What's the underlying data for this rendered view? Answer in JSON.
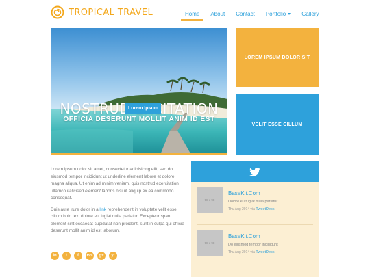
{
  "header": {
    "brand": "TROPICAL TRAVEL",
    "nav": [
      {
        "label": "Home",
        "active": true
      },
      {
        "label": "About"
      },
      {
        "label": "Contact"
      },
      {
        "label": "Portfolio",
        "dropdown": true
      },
      {
        "label": "Gallery"
      }
    ]
  },
  "hero": {
    "title": "NOSTRUD EXCITATION",
    "subtitle": "OFFICIA DESERUNT MOLLIT ANIM ID EST",
    "button": "Lorem Ipsum"
  },
  "boxes": [
    {
      "label": "LOREM IPSUM DOLOR SIT",
      "color": "#f3b23e"
    },
    {
      "label": "VELIT ESSE CILLUM",
      "color": "#2ea1db"
    }
  ],
  "content": {
    "p1_a": "Lorem ipsum dolor sit amet, consectetur adipisicing elit, sed do eiusmod tempor incididunt ut ",
    "p1_link": "underline element",
    "p1_b": " labore et dolore magna aliqua. Ut enim ad minim veniam, quis nostrud exercitation ullamco ",
    "p1_em": "italicised element",
    "p1_c": " laboris nisi ut aliquip ex ea commodo consequat.",
    "p2_a": "Duis aute irure dolor in a ",
    "p2_link": "link",
    "p2_b": " reprehenderit in voluptate velit esse cillum bold text dolore eu fugiat nulla pariatur. Excepteur span element sint occaecat cupidatat non proident, sunt in culpa qui officia deserunt mollit anim id est laborum."
  },
  "social": [
    "in",
    "t",
    "f",
    "rss",
    "g+",
    "yt"
  ],
  "twitter": {
    "items": [
      {
        "thumb": "98 x 98",
        "title": "BaseKit.Com",
        "desc": "Dolore eu fugiat nulla pariatur",
        "date": "Thu Aug 2014 via ",
        "via": "TweetDeck"
      },
      {
        "thumb": "98 x 98",
        "title": "BaseKit.Com",
        "desc": "Do eiusmod tempor incididunt",
        "date": "Thu Aug 2014 via ",
        "via": "TweetDeck"
      }
    ]
  },
  "colors": {
    "accent": "#f3b23e",
    "primary": "#2ea1db",
    "panel": "#fcefd3"
  }
}
